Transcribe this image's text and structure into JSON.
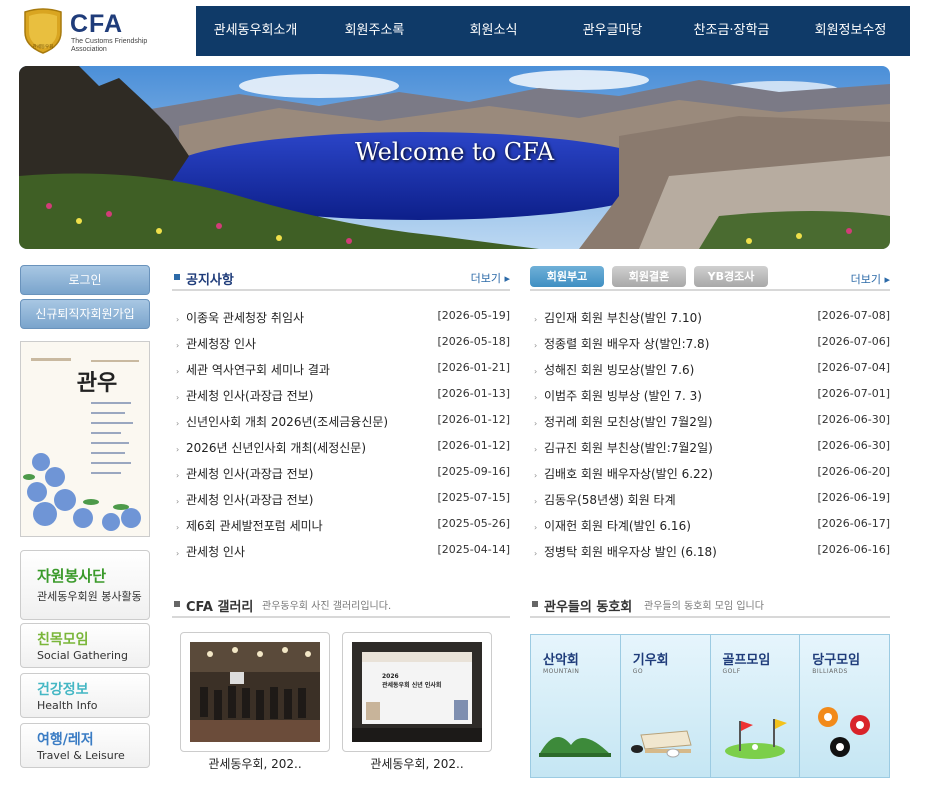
{
  "logo": {
    "brand": "CFA",
    "seal_text": "관세동우회",
    "tagline": "The Customs Friendship Association"
  },
  "nav": [
    "관세동우회소개",
    "회원주소록",
    "회원소식",
    "관우글마당",
    "찬조금·장학금",
    "회원정보수정"
  ],
  "banner": {
    "text": "Welcome to CFA"
  },
  "left": {
    "login": "로그인",
    "join": "신규퇴직자회원가입",
    "magazine_title": "관우",
    "boxes": [
      {
        "kt": "자원봉사단",
        "et": "관세동우회원 봉사활동",
        "color": "#3a9a2a"
      },
      {
        "kt": "친목모임",
        "et": "Social Gathering",
        "color": "#7ab63a"
      },
      {
        "kt": "건강정보",
        "et": "Health Info",
        "color": "#45b7c4"
      },
      {
        "kt": "여행/레저",
        "et": "Travel & Leisure",
        "color": "#3a7cc4"
      }
    ]
  },
  "notice": {
    "title": "공지사항",
    "more": "더보기",
    "items": [
      {
        "t": "이종욱 관세청장 취임사",
        "d": "[2026-05-19]"
      },
      {
        "t": "관세청장 인사",
        "d": "[2026-05-18]"
      },
      {
        "t": "세관 역사연구회 세미나 결과",
        "d": "[2026-01-21]"
      },
      {
        "t": "관세청 인사(과장급 전보)",
        "d": "[2026-01-13]"
      },
      {
        "t": "신년인사회 개최 2026년(조세금융신문)",
        "d": "[2026-01-12]"
      },
      {
        "t": "2026년 신년인사회 개최(세정신문)",
        "d": "[2026-01-12]"
      },
      {
        "t": "관세청 인사(과장급 전보)",
        "d": "[2025-09-16]"
      },
      {
        "t": "관세청 인사(과장급 전보)",
        "d": "[2025-07-15]"
      },
      {
        "t": "제6회 관세발전포럼 세미나",
        "d": "[2025-05-26]"
      },
      {
        "t": "관세청 인사",
        "d": "[2025-04-14]"
      }
    ]
  },
  "member": {
    "tabs": [
      "회원부고",
      "회원결혼",
      "YB경조사"
    ],
    "more": "더보기",
    "items": [
      {
        "t": "김인재 회원 부친상(발인 7.10)",
        "d": "[2026-07-08]"
      },
      {
        "t": "정종렬 회원 배우자 상(발인:7.8)",
        "d": "[2026-07-06]"
      },
      {
        "t": "성해진 회원 빙모상(발인 7.6)",
        "d": "[2026-07-04]"
      },
      {
        "t": "이범주 회원 빙부상 (발인 7. 3)",
        "d": "[2026-07-01]"
      },
      {
        "t": "정귀례 회원 모친상(발인 7월2일)",
        "d": "[2026-06-30]"
      },
      {
        "t": "김규진 회원 부친상(발인:7월2일)",
        "d": "[2026-06-30]"
      },
      {
        "t": "김배호 회원 배우자상(발인 6.22)",
        "d": "[2026-06-20]"
      },
      {
        "t": "김동우(58년생) 회원 타계",
        "d": "[2026-06-19]"
      },
      {
        "t": "이재헌 회원 타계(발인 6.16)",
        "d": "[2026-06-17]"
      },
      {
        "t": "정병탁 회원 배우자상 발인 (6.18)",
        "d": "[2026-06-16]"
      }
    ]
  },
  "gallery": {
    "title": "CFA 갤러리",
    "sub": "관우동우회 사진 갤러리입니다.",
    "items": [
      {
        "cap": "관세동우회, 202.."
      },
      {
        "cap": "관세동우회, 202..",
        "slide_year": "2026",
        "slide_title": "관세동우회 신년 인사회"
      }
    ]
  },
  "clubs": {
    "title": "관우들의 동호회",
    "sub": "관우들의 동호회 모임 입니다",
    "items": [
      {
        "kn": "산악회",
        "en": "MOUNTAIN"
      },
      {
        "kn": "기우회",
        "en": "GO"
      },
      {
        "kn": "골프모임",
        "en": "GOLF"
      },
      {
        "kn": "당구모임",
        "en": "BILLIARDS"
      }
    ]
  }
}
